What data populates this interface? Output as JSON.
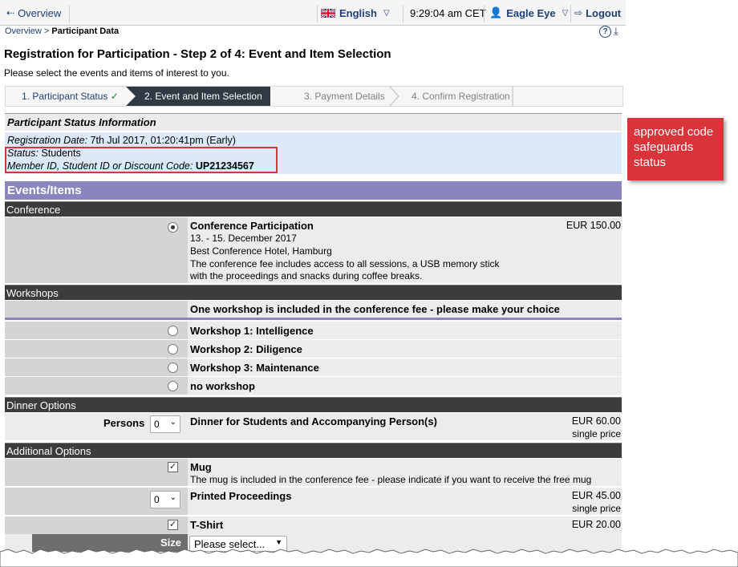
{
  "topbar": {
    "overview": "Overview",
    "language": "English",
    "time": "9:29:04 am CET",
    "user": "Eagle Eye",
    "logout": "Logout"
  },
  "breadcrumb": {
    "root": "Overview",
    "sep": " > ",
    "current": "Participant Data"
  },
  "page": {
    "title": "Registration for Participation - Step 2 of 4: Event and Item Selection",
    "subtitle": "Please select the events and items of interest to you."
  },
  "steps": [
    {
      "label": "1. Participant Status",
      "check": "✓"
    },
    {
      "label": "2. Event and Item Selection"
    },
    {
      "label": "3. Payment Details"
    },
    {
      "label": "4. Confirm Registration"
    }
  ],
  "status_info": {
    "header": "Participant Status Information",
    "reg_label": "Registration Date:",
    "reg_value": " 7th Jul 2017, 01:20:41pm (Early)",
    "status_label": "Status:",
    "status_value": " Students",
    "code_label": "Member ID, Student ID or Discount Code:",
    "code_value": "UP21234567"
  },
  "callout": "approved code safeguards status",
  "events": {
    "header": "Events/Items",
    "conference": {
      "section": "Conference",
      "name": "Conference Participation",
      "price": "EUR 150.00",
      "lines": [
        "13. - 15. December 2017",
        "Best Conference Hotel, Hamburg",
        "The conference fee includes access to all sessions, a USB memory stick",
        "with the proceedings and snacks during coffee breaks."
      ]
    },
    "workshops": {
      "section": "Workshops",
      "note": "One workshop is included in the conference fee - please make your choice",
      "options": [
        "Workshop 1: Intelligence",
        "Workshop 2: Diligence",
        "Workshop 3: Maintenance",
        "no workshop"
      ]
    },
    "dinner": {
      "section": "Dinner Options",
      "persons_label": "Persons",
      "qty": "0",
      "name": "Dinner for Students and Accompanying Person(s)",
      "price": "EUR 60.00",
      "price_note": "single price"
    },
    "additional": {
      "section": "Additional Options",
      "mug": {
        "name": "Mug",
        "desc": "The mug is included in the conference fee - please indicate if you want to receive the free mug"
      },
      "proceedings": {
        "qty": "0",
        "name": "Printed Proceedings",
        "price": "EUR 45.00",
        "price_note": "single price"
      },
      "tshirt": {
        "name": "T-Shirt",
        "price": "EUR 20.00",
        "size_label": "Size",
        "size_placeholder": "Please select..."
      }
    }
  }
}
